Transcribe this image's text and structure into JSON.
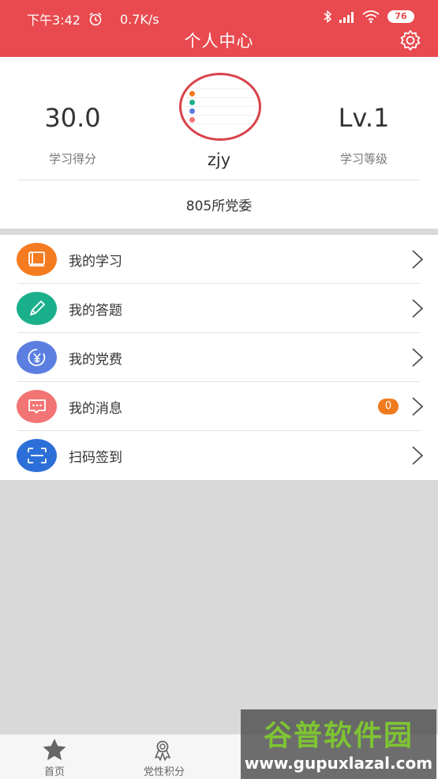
{
  "status_bar": {
    "time": "下午3:42",
    "speed": "0.7K/s",
    "battery": "76"
  },
  "header": {
    "title": "个人中心"
  },
  "profile": {
    "score_value": "30.0",
    "score_label": "学习得分",
    "level_value": "Lv.1",
    "level_label": "学习等级",
    "username": "zjy",
    "org": "805所党委"
  },
  "menu": {
    "items": [
      {
        "label": "我的学习",
        "color": "#f47b20"
      },
      {
        "label": "我的答题",
        "color": "#1bb08c"
      },
      {
        "label": "我的党费",
        "color": "#5b7fe0"
      },
      {
        "label": "我的消息",
        "color": "#f27474",
        "badge": "0"
      },
      {
        "label": "扫码签到",
        "color": "#2d6fd8"
      }
    ]
  },
  "tabbar": {
    "tabs": [
      {
        "label": "首页"
      },
      {
        "label": "党性积分"
      }
    ]
  },
  "watermark": {
    "top": "谷普软件园",
    "bottom": "www.gupuxlazal.com"
  },
  "colors": {
    "header": "#e84a4f",
    "badge": "#f07a1e"
  }
}
